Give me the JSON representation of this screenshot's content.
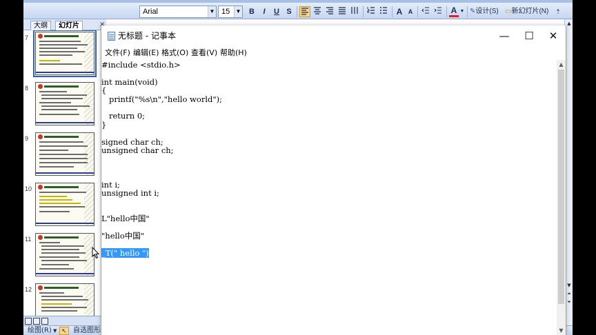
{
  "ppt": {
    "toolbar": {
      "font_name": "Arial",
      "font_size": "15",
      "bold": "B",
      "italic": "I",
      "underline": "U",
      "shadow": "S",
      "grow_font": "A",
      "shrink_font": "A",
      "font_color": "A",
      "design_label": "设计(S)",
      "new_slide_label": "新幻灯片(N)"
    },
    "pane_tabs": [
      "大纲",
      "幻灯片"
    ],
    "pane_close": "×",
    "slides": [
      {
        "num": "7",
        "selected": true
      },
      {
        "num": "8",
        "selected": false
      },
      {
        "num": "9",
        "selected": false
      },
      {
        "num": "10",
        "selected": false
      },
      {
        "num": "11",
        "selected": false
      },
      {
        "num": "12",
        "selected": false
      }
    ],
    "draw_bar": {
      "draw_label": "绘图(R)",
      "autoshape_label": "自选图形"
    }
  },
  "notepad": {
    "title": "无标题 - 记事本",
    "controls": {
      "minimize": "—",
      "maximize": "☐",
      "close": "✕"
    },
    "menu": [
      "文件(F)",
      "编辑(E)",
      "格式(O)",
      "查看(V)",
      "帮助(H)"
    ],
    "lines": [
      "#include <stdio.h>",
      "",
      "int main(void)",
      "{",
      "   printf(\"%s\\n\",\"hello world\");",
      "",
      "   return 0;",
      "}",
      "",
      "signed char ch;",
      "unsigned char ch;",
      "",
      "",
      "",
      "int i;",
      "unsigned int i;",
      "",
      "",
      "L\"hello中国\"",
      "",
      "\"hello中国\"",
      "",
      "_T(\" hello \")"
    ],
    "selected_line": 22
  },
  "colors": {
    "selection": "#3399ff",
    "ppt_toolbar": "#c6d7f1",
    "font_color_underline": "#e02020"
  }
}
